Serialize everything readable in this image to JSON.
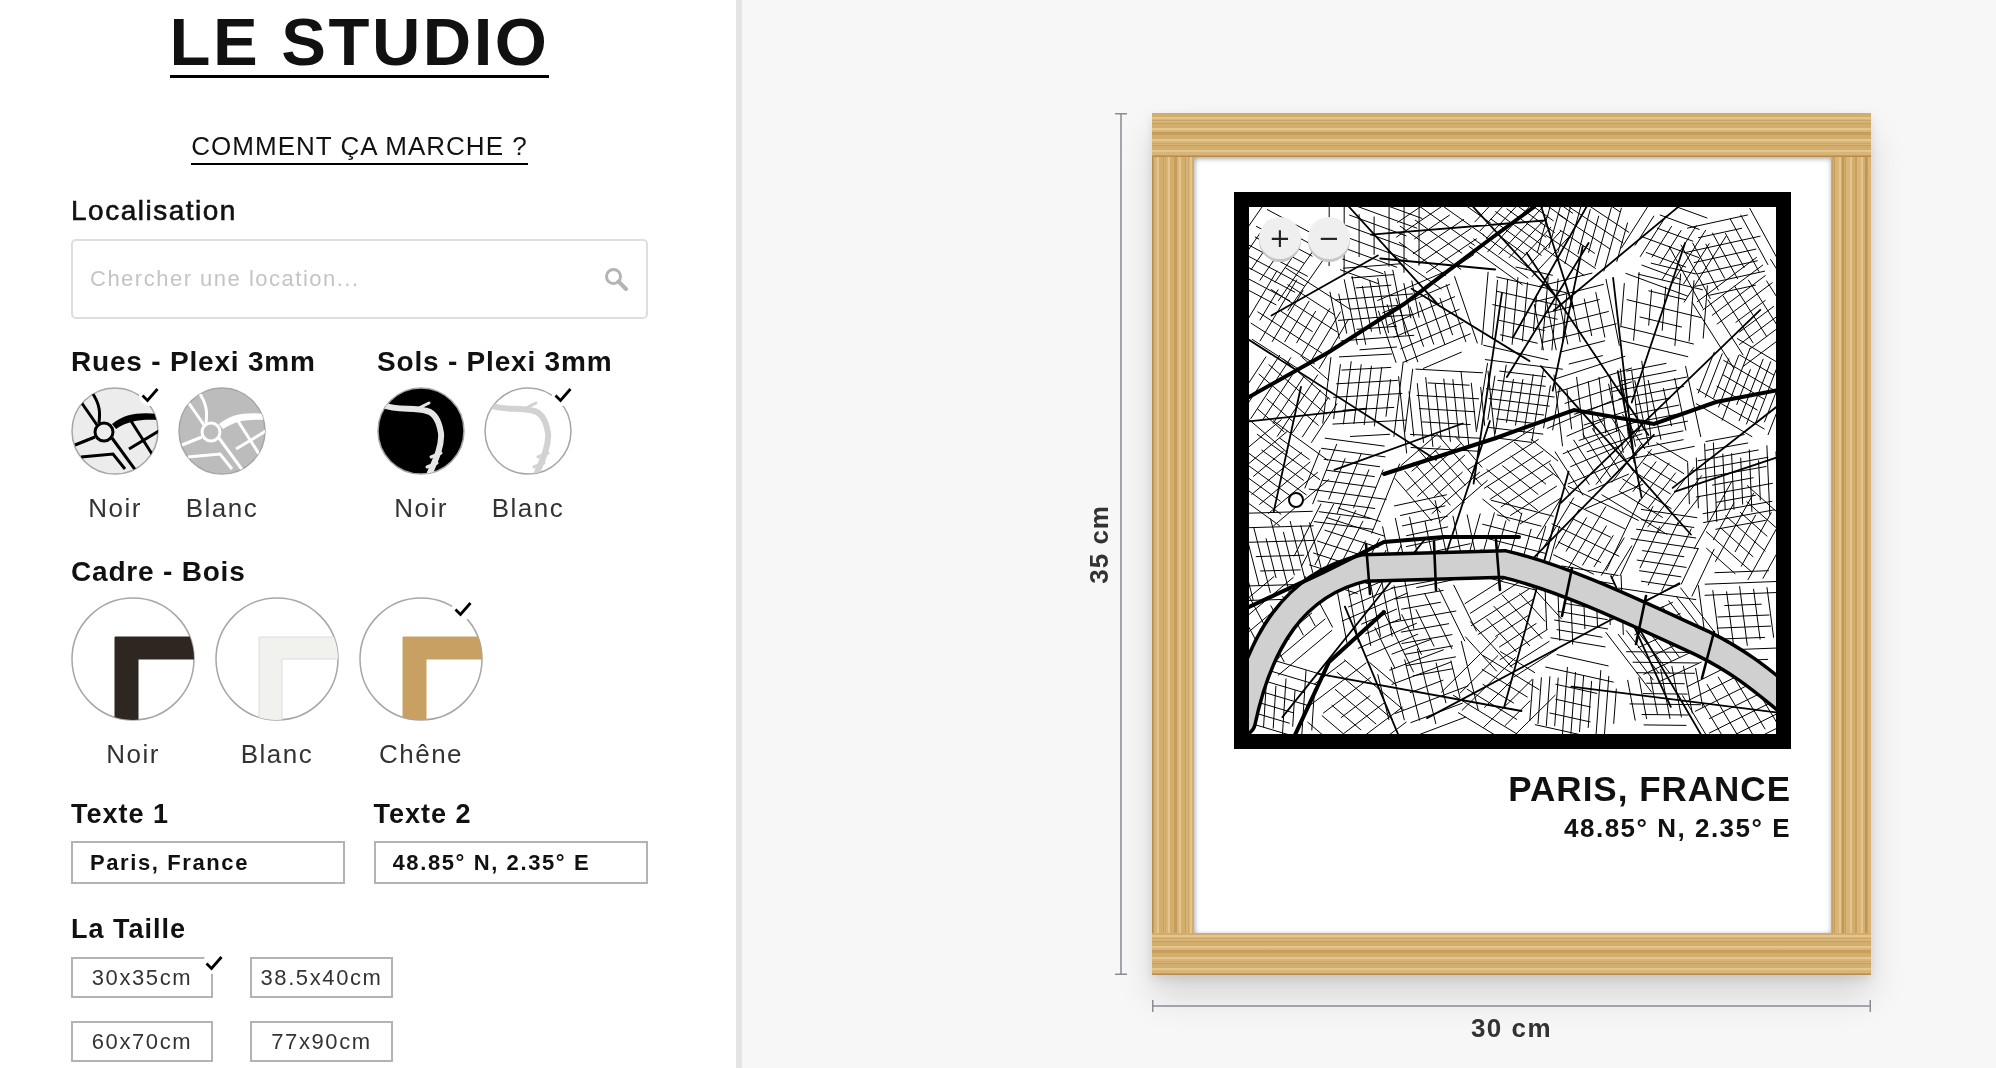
{
  "header": {
    "title": "LE STUDIO",
    "help_link": "COMMENT ÇA MARCHE ?"
  },
  "location": {
    "label": "Localisation",
    "search": {
      "placeholder": "Chercher une location..."
    }
  },
  "option_groups": [
    {
      "title": "Rues - Plexi 3mm",
      "kind": "streets",
      "options": [
        {
          "label": "Noir",
          "color": "#000000",
          "selected": true
        },
        {
          "label": "Blanc",
          "color": "#ffffff",
          "selected": false
        }
      ]
    },
    {
      "title": "Sols - Plexi 3mm",
      "kind": "ground",
      "options": [
        {
          "label": "Noir",
          "color": "#000000",
          "selected": false
        },
        {
          "label": "Blanc",
          "color": "#ffffff",
          "selected": true
        }
      ]
    },
    {
      "title": "Cadre - Bois",
      "kind": "frame",
      "options": [
        {
          "label": "Noir",
          "color": "#2e2620",
          "selected": false
        },
        {
          "label": "Blanc",
          "color": "#f1f1ee",
          "selected": false
        },
        {
          "label": "Chêne",
          "color": "#c9a064",
          "selected": true
        }
      ]
    }
  ],
  "texts": [
    {
      "label": "Texte 1",
      "value": "Paris, France"
    },
    {
      "label": "Texte 2",
      "value": "48.85° N, 2.35° E"
    }
  ],
  "sizes": {
    "label": "La Taille",
    "options": [
      {
        "label": "30x35cm",
        "selected": true
      },
      {
        "label": "38.5x40cm",
        "selected": false
      },
      {
        "label": "60x70cm",
        "selected": false
      },
      {
        "label": "77x90cm",
        "selected": false
      }
    ]
  },
  "preview": {
    "zoom_buttons": [
      "+",
      "−"
    ],
    "title": "PARIS, FRANCE",
    "subtitle": "48.85° N, 2.35° E",
    "height_label": "35 cm",
    "width_label": "30 cm"
  }
}
